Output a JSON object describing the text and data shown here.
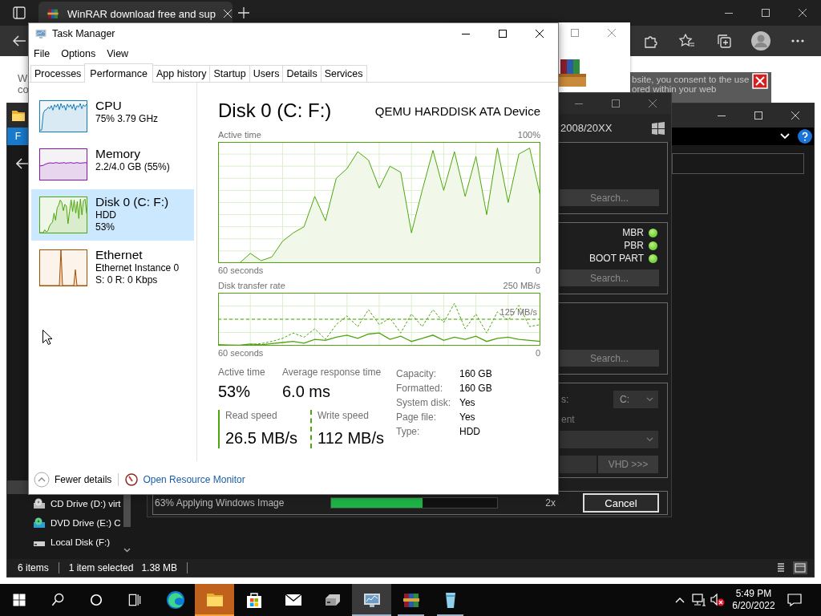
{
  "browser": {
    "tab_title": "WinRAR download free and sup",
    "page_fragments": [
      "W",
      "co"
    ],
    "banner_lines": [
      "bsite, you consent to the use",
      "ored within your web"
    ]
  },
  "explorer": {
    "ribbon_tab": "F",
    "nav_items": [
      {
        "kind": "cd",
        "label": "CD Drive (D:) virt"
      },
      {
        "kind": "dvd",
        "label": "DVD Drive (E:) C"
      },
      {
        "kind": "disk",
        "label": "Local Disk (F:)"
      }
    ],
    "status": {
      "items": "6 items",
      "selection": "1 item selected",
      "size": "1.38 MB"
    }
  },
  "installer": {
    "edition": "2008/20XX",
    "panels": [
      {
        "kind": "search",
        "button": "Search..."
      },
      {
        "kind": "boot",
        "checks": [
          {
            "label": "MBR",
            "on": true
          },
          {
            "label": "PBR",
            "on": true
          },
          {
            "label": "BOOT PART",
            "on": true
          }
        ],
        "button": "Search..."
      },
      {
        "kind": "search",
        "button": "Search..."
      },
      {
        "kind": "target",
        "label_tail": "s:",
        "drive": "C:",
        "option_tail": "ent",
        "vhd_button": "VHD >>>"
      }
    ],
    "progress": {
      "text": "63% Applying Windows Image",
      "level": 0.55
    },
    "speed": "2x",
    "cancel": "Cancel"
  },
  "task_manager": {
    "title": "Task Manager",
    "menu": [
      "File",
      "Options",
      "View"
    ],
    "tabs": [
      {
        "label": "Processes",
        "selected": false
      },
      {
        "label": "Performance",
        "selected": true
      },
      {
        "label": "App history",
        "selected": false
      },
      {
        "label": "Startup",
        "selected": false
      },
      {
        "label": "Users",
        "selected": false
      },
      {
        "label": "Details",
        "selected": false
      },
      {
        "label": "Services",
        "selected": false
      }
    ],
    "resources": [
      {
        "kind": "cpu",
        "name": "CPU",
        "lines": [
          "75% 3.79 GHz"
        ],
        "selected": false
      },
      {
        "kind": "memory",
        "name": "Memory",
        "lines": [
          "2.2/4.0 GB (55%)"
        ],
        "selected": false
      },
      {
        "kind": "disk",
        "name": "Disk 0 (C: F:)",
        "lines": [
          "HDD",
          "53%"
        ],
        "selected": true
      },
      {
        "kind": "ethernet",
        "name": "Ethernet",
        "lines": [
          "Ethernet Instance 0",
          "S: 0 R: 0 Kbps"
        ],
        "selected": false
      }
    ],
    "detail": {
      "title": "Disk 0 (C: F:)",
      "device": "QEMU HARDDISK ATA Device",
      "charts": [
        {
          "kind": "area",
          "title": "Active time",
          "scale_label": "100%",
          "start_label": "60 seconds",
          "end_label": "0"
        },
        {
          "kind": "lines",
          "title": "Disk transfer rate",
          "scale_label": "250 MB/s",
          "mid_label": "125 MB/s",
          "start_label": "60 seconds",
          "end_label": "0"
        }
      ],
      "stats": [
        {
          "label": "Active time",
          "value": "53%"
        },
        {
          "label": "Average response time",
          "value": "6.0 ms"
        }
      ],
      "speeds": [
        {
          "kind": "read",
          "label": "Read speed",
          "value": "26.5 MB/s"
        },
        {
          "kind": "write",
          "label": "Write speed",
          "value": "112 MB/s"
        }
      ],
      "properties": [
        {
          "label": "Capacity:",
          "value": "160 GB"
        },
        {
          "label": "Formatted:",
          "value": "160 GB"
        },
        {
          "label": "System disk:",
          "value": "Yes"
        },
        {
          "label": "Page file:",
          "value": "Yes"
        },
        {
          "label": "Type:",
          "value": "HDD"
        }
      ]
    },
    "footer": {
      "fewer_details": "Fewer details",
      "resource_monitor": "Open Resource Monitor"
    }
  },
  "taskbar": {
    "apps": [
      {
        "kind": "swirl",
        "running": false,
        "focused": false,
        "flashing": false
      },
      {
        "kind": "folder",
        "running": true,
        "focused": false,
        "flashing": true
      },
      {
        "kind": "bag",
        "running": false,
        "focused": false,
        "flashing": false
      },
      {
        "kind": "envelope",
        "running": false,
        "focused": false,
        "flashing": false
      },
      {
        "kind": "drive",
        "running": false,
        "focused": false,
        "flashing": false
      },
      {
        "kind": "monitor",
        "running": true,
        "focused": true,
        "flashing": false
      },
      {
        "kind": "books",
        "running": true,
        "focused": false,
        "flashing": false
      },
      {
        "kind": "cup",
        "running": true,
        "focused": false,
        "flashing": false
      }
    ],
    "time": "5:49 PM",
    "date": "6/20/2022"
  }
}
